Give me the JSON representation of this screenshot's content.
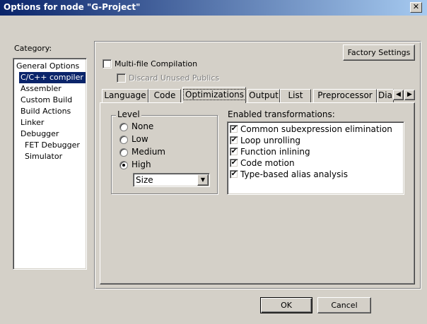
{
  "window": {
    "title": "Options for node \"G-Project\"",
    "close_glyph": "✕"
  },
  "category": {
    "label": "Category:",
    "items": [
      {
        "label": "General Options"
      },
      {
        "label": "C/C++ compiler"
      },
      {
        "label": "Assembler"
      },
      {
        "label": "Custom Build"
      },
      {
        "label": "Build Actions"
      },
      {
        "label": "Linker"
      },
      {
        "label": "Debugger"
      },
      {
        "label": "FET Debugger"
      },
      {
        "label": "Simulator"
      }
    ]
  },
  "panel": {
    "factory_settings": "Factory Settings",
    "multi_file_label": "Multi-file Compilation",
    "discard_unused_label": "Discard Unused Publics"
  },
  "tabs": [
    {
      "label": "Language"
    },
    {
      "label": "Code"
    },
    {
      "label": "Optimizations"
    },
    {
      "label": "Output"
    },
    {
      "label": "List"
    },
    {
      "label": "Preprocessor"
    },
    {
      "label": "Dia"
    }
  ],
  "level": {
    "legend": "Level",
    "options": [
      {
        "label": "None",
        "checked": false
      },
      {
        "label": "Low",
        "checked": false
      },
      {
        "label": "Medium",
        "checked": false
      },
      {
        "label": "High",
        "checked": true
      }
    ],
    "select_value": "Size"
  },
  "transformations": {
    "label": "Enabled transformations:",
    "items": [
      {
        "label": "Common subexpression elimination",
        "checked": true
      },
      {
        "label": "Loop unrolling",
        "checked": true
      },
      {
        "label": "Function inlining",
        "checked": true
      },
      {
        "label": "Code motion",
        "checked": true
      },
      {
        "label": "Type-based alias analysis",
        "checked": true
      }
    ]
  },
  "buttons": {
    "ok": "OK",
    "cancel": "Cancel"
  }
}
